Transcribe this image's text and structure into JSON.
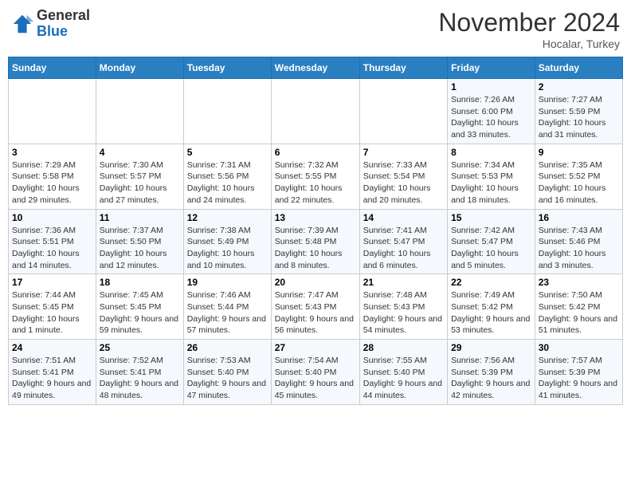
{
  "header": {
    "logo_general": "General",
    "logo_blue": "Blue",
    "month_title": "November 2024",
    "location": "Hocalar, Turkey"
  },
  "days_of_week": [
    "Sunday",
    "Monday",
    "Tuesday",
    "Wednesday",
    "Thursday",
    "Friday",
    "Saturday"
  ],
  "weeks": [
    [
      {
        "day": "",
        "info": ""
      },
      {
        "day": "",
        "info": ""
      },
      {
        "day": "",
        "info": ""
      },
      {
        "day": "",
        "info": ""
      },
      {
        "day": "",
        "info": ""
      },
      {
        "day": "1",
        "info": "Sunrise: 7:26 AM\nSunset: 6:00 PM\nDaylight: 10 hours and 33 minutes."
      },
      {
        "day": "2",
        "info": "Sunrise: 7:27 AM\nSunset: 5:59 PM\nDaylight: 10 hours and 31 minutes."
      }
    ],
    [
      {
        "day": "3",
        "info": "Sunrise: 7:29 AM\nSunset: 5:58 PM\nDaylight: 10 hours and 29 minutes."
      },
      {
        "day": "4",
        "info": "Sunrise: 7:30 AM\nSunset: 5:57 PM\nDaylight: 10 hours and 27 minutes."
      },
      {
        "day": "5",
        "info": "Sunrise: 7:31 AM\nSunset: 5:56 PM\nDaylight: 10 hours and 24 minutes."
      },
      {
        "day": "6",
        "info": "Sunrise: 7:32 AM\nSunset: 5:55 PM\nDaylight: 10 hours and 22 minutes."
      },
      {
        "day": "7",
        "info": "Sunrise: 7:33 AM\nSunset: 5:54 PM\nDaylight: 10 hours and 20 minutes."
      },
      {
        "day": "8",
        "info": "Sunrise: 7:34 AM\nSunset: 5:53 PM\nDaylight: 10 hours and 18 minutes."
      },
      {
        "day": "9",
        "info": "Sunrise: 7:35 AM\nSunset: 5:52 PM\nDaylight: 10 hours and 16 minutes."
      }
    ],
    [
      {
        "day": "10",
        "info": "Sunrise: 7:36 AM\nSunset: 5:51 PM\nDaylight: 10 hours and 14 minutes."
      },
      {
        "day": "11",
        "info": "Sunrise: 7:37 AM\nSunset: 5:50 PM\nDaylight: 10 hours and 12 minutes."
      },
      {
        "day": "12",
        "info": "Sunrise: 7:38 AM\nSunset: 5:49 PM\nDaylight: 10 hours and 10 minutes."
      },
      {
        "day": "13",
        "info": "Sunrise: 7:39 AM\nSunset: 5:48 PM\nDaylight: 10 hours and 8 minutes."
      },
      {
        "day": "14",
        "info": "Sunrise: 7:41 AM\nSunset: 5:47 PM\nDaylight: 10 hours and 6 minutes."
      },
      {
        "day": "15",
        "info": "Sunrise: 7:42 AM\nSunset: 5:47 PM\nDaylight: 10 hours and 5 minutes."
      },
      {
        "day": "16",
        "info": "Sunrise: 7:43 AM\nSunset: 5:46 PM\nDaylight: 10 hours and 3 minutes."
      }
    ],
    [
      {
        "day": "17",
        "info": "Sunrise: 7:44 AM\nSunset: 5:45 PM\nDaylight: 10 hours and 1 minute."
      },
      {
        "day": "18",
        "info": "Sunrise: 7:45 AM\nSunset: 5:45 PM\nDaylight: 9 hours and 59 minutes."
      },
      {
        "day": "19",
        "info": "Sunrise: 7:46 AM\nSunset: 5:44 PM\nDaylight: 9 hours and 57 minutes."
      },
      {
        "day": "20",
        "info": "Sunrise: 7:47 AM\nSunset: 5:43 PM\nDaylight: 9 hours and 56 minutes."
      },
      {
        "day": "21",
        "info": "Sunrise: 7:48 AM\nSunset: 5:43 PM\nDaylight: 9 hours and 54 minutes."
      },
      {
        "day": "22",
        "info": "Sunrise: 7:49 AM\nSunset: 5:42 PM\nDaylight: 9 hours and 53 minutes."
      },
      {
        "day": "23",
        "info": "Sunrise: 7:50 AM\nSunset: 5:42 PM\nDaylight: 9 hours and 51 minutes."
      }
    ],
    [
      {
        "day": "24",
        "info": "Sunrise: 7:51 AM\nSunset: 5:41 PM\nDaylight: 9 hours and 49 minutes."
      },
      {
        "day": "25",
        "info": "Sunrise: 7:52 AM\nSunset: 5:41 PM\nDaylight: 9 hours and 48 minutes."
      },
      {
        "day": "26",
        "info": "Sunrise: 7:53 AM\nSunset: 5:40 PM\nDaylight: 9 hours and 47 minutes."
      },
      {
        "day": "27",
        "info": "Sunrise: 7:54 AM\nSunset: 5:40 PM\nDaylight: 9 hours and 45 minutes."
      },
      {
        "day": "28",
        "info": "Sunrise: 7:55 AM\nSunset: 5:40 PM\nDaylight: 9 hours and 44 minutes."
      },
      {
        "day": "29",
        "info": "Sunrise: 7:56 AM\nSunset: 5:39 PM\nDaylight: 9 hours and 42 minutes."
      },
      {
        "day": "30",
        "info": "Sunrise: 7:57 AM\nSunset: 5:39 PM\nDaylight: 9 hours and 41 minutes."
      }
    ]
  ]
}
